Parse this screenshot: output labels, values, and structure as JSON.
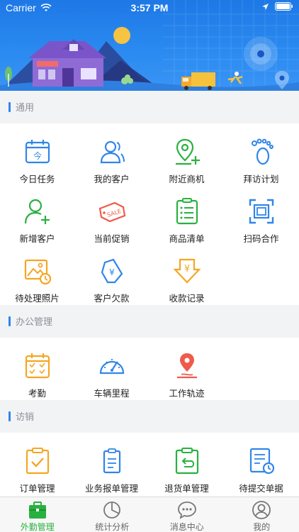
{
  "status_bar": {
    "carrier": "Carrier",
    "time": "3:57 PM"
  },
  "sections": [
    {
      "title": "通用",
      "items": [
        {
          "label": "今日任务",
          "icon": "calendar-today-icon",
          "glyph": "今"
        },
        {
          "label": "我的客户",
          "icon": "customer-icon"
        },
        {
          "label": "附近商机",
          "icon": "location-add-icon"
        },
        {
          "label": "拜访计划",
          "icon": "footprint-icon"
        },
        {
          "label": "新增客户",
          "icon": "add-user-icon"
        },
        {
          "label": "当前促销",
          "icon": "sale-tag-icon",
          "glyph": "SALE"
        },
        {
          "label": "商品清单",
          "icon": "list-icon"
        },
        {
          "label": "扫码合作",
          "icon": "scan-icon"
        },
        {
          "label": "待处理照片",
          "icon": "photo-clock-icon"
        },
        {
          "label": "客户欠款",
          "icon": "debt-icon",
          "glyph": "¥"
        },
        {
          "label": "收款记录",
          "icon": "yen-download-icon",
          "glyph": "¥"
        }
      ]
    },
    {
      "title": "办公管理",
      "items": [
        {
          "label": "考勤",
          "icon": "attendance-calendar-icon"
        },
        {
          "label": "车辆里程",
          "icon": "speedometer-icon"
        },
        {
          "label": "工作轨迹",
          "icon": "track-pin-icon"
        }
      ]
    },
    {
      "title": "访销",
      "items": [
        {
          "label": "订单管理",
          "icon": "order-check-icon"
        },
        {
          "label": "业务报单管理",
          "icon": "report-clipboard-icon"
        },
        {
          "label": "退货单管理",
          "icon": "return-clipboard-icon"
        },
        {
          "label": "待提交单据",
          "icon": "pending-doc-icon"
        }
      ]
    }
  ],
  "tabbar": [
    {
      "label": "外勤管理",
      "icon": "briefcase-icon",
      "active": true
    },
    {
      "label": "统计分析",
      "icon": "pie-chart-icon",
      "active": false
    },
    {
      "label": "消息中心",
      "icon": "chat-icon",
      "active": false
    },
    {
      "label": "我的",
      "icon": "profile-icon",
      "active": false
    }
  ],
  "colors": {
    "accent_blue": "#2f86e8",
    "green": "#29b13f",
    "orange": "#f5a623",
    "red": "#f05a4a",
    "tab_active": "#29b13f"
  }
}
